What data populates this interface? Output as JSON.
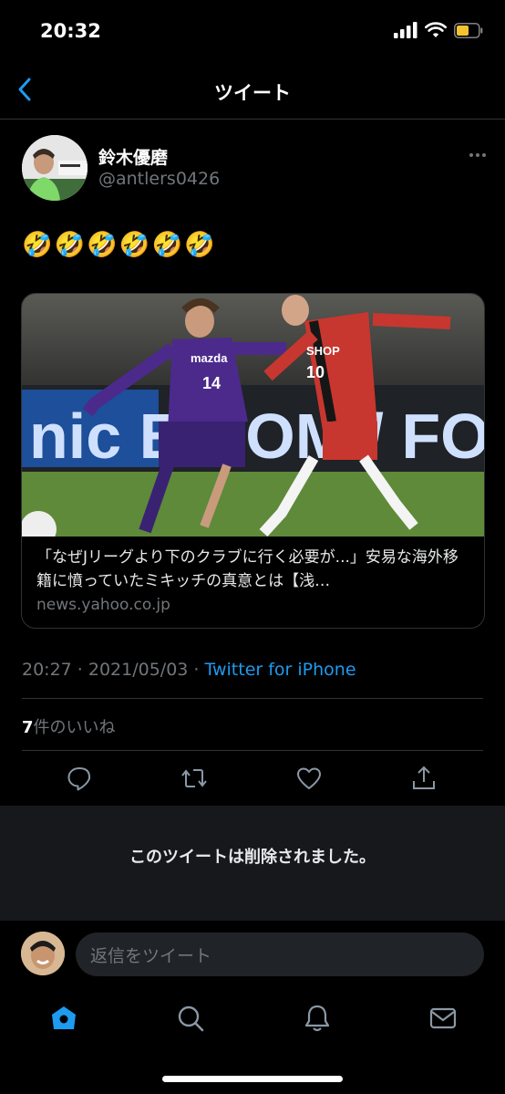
{
  "status": {
    "time": "20:32"
  },
  "header": {
    "title": "ツイート"
  },
  "tweet": {
    "author_name": "鈴木優磨",
    "author_handle": "@antlers0426",
    "emojis": "🤣🤣🤣🤣🤣🤣",
    "card": {
      "title": "「なぜJリーグより下のクラブに行く必要が...」安易な海外移籍に憤っていたミキッチの真意とは【浅…",
      "domain": "news.yahoo.co.jp",
      "image_text": {
        "left_jersey": "mazda",
        "left_number": "14",
        "right_jersey": "SHOP",
        "right_number": "10",
        "banner": "nic  E.COM / FO"
      }
    },
    "timestamp": "20:27 · 2021/05/03 · ",
    "source": "Twitter for iPhone",
    "likes_count": "7",
    "likes_label": "件のいいね"
  },
  "deleted_notice": "このツイートは削除されました。",
  "reply": {
    "placeholder": "返信をツイート"
  },
  "colors": {
    "accent": "#1d9bf0",
    "background": "#000000",
    "muted": "#71767b"
  },
  "icons": [
    "back-chevron-icon",
    "more-icon",
    "reply-icon",
    "retweet-icon",
    "like-icon",
    "share-icon",
    "home-icon",
    "search-icon",
    "notifications-icon",
    "messages-icon"
  ]
}
